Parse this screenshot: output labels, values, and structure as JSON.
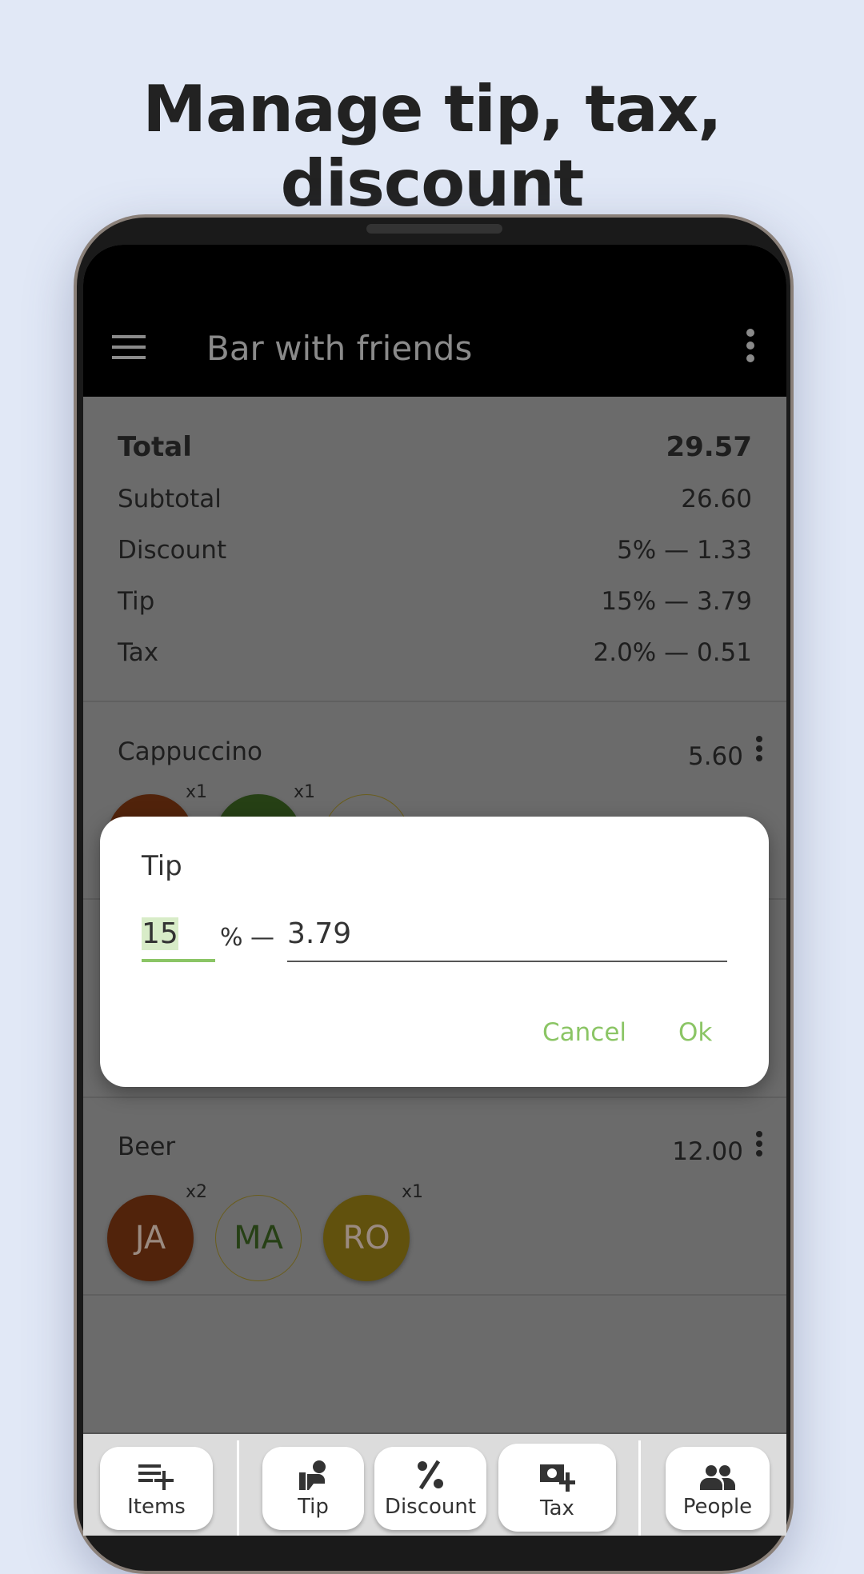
{
  "headline": "Manage tip, tax, discount",
  "app_bar": {
    "title": "Bar with friends",
    "menu_icon": "hamburger-icon",
    "more_icon": "more-vert-icon"
  },
  "summary": {
    "total": {
      "label": "Total",
      "value": "29.57"
    },
    "subtotal": {
      "label": "Subtotal",
      "value": "26.60"
    },
    "discount": {
      "label": "Discount",
      "value": "5% — 1.33"
    },
    "tip": {
      "label": "Tip",
      "value": "15% — 3.79"
    },
    "tax": {
      "label": "Tax",
      "value": "2.0% — 0.51"
    }
  },
  "items": [
    {
      "name": "Cappuccino",
      "price": "5.60",
      "people": [
        {
          "initials": "",
          "qty": "x1",
          "color": "#c0541a"
        },
        {
          "initials": "",
          "qty": "x1",
          "color": "#5a9a32"
        },
        {
          "initials": "",
          "qty": "",
          "color": "#ffffff"
        }
      ]
    },
    {
      "name": "Beer",
      "price": "12.00",
      "people": [
        {
          "initials": "JA",
          "qty": "x2",
          "color": "#c0541a"
        },
        {
          "initials": "MA",
          "qty": "",
          "color": "#ffffff"
        },
        {
          "initials": "RO",
          "qty": "x1",
          "color": "#e8c21f"
        }
      ]
    }
  ],
  "dialog": {
    "title": "Tip",
    "percent": "15",
    "percent_sign": "% —",
    "amount": "3.79",
    "cancel": "Cancel",
    "ok": "Ok",
    "accent": "#8bc565"
  },
  "bottom_nav": [
    {
      "label": "Items",
      "icon": "playlist-add-icon"
    },
    {
      "label": "Tip",
      "icon": "tip-hand-icon"
    },
    {
      "label": "Discount",
      "icon": "percent-icon"
    },
    {
      "label": "Tax",
      "icon": "money-add-icon"
    },
    {
      "label": "People",
      "icon": "people-icon"
    }
  ]
}
